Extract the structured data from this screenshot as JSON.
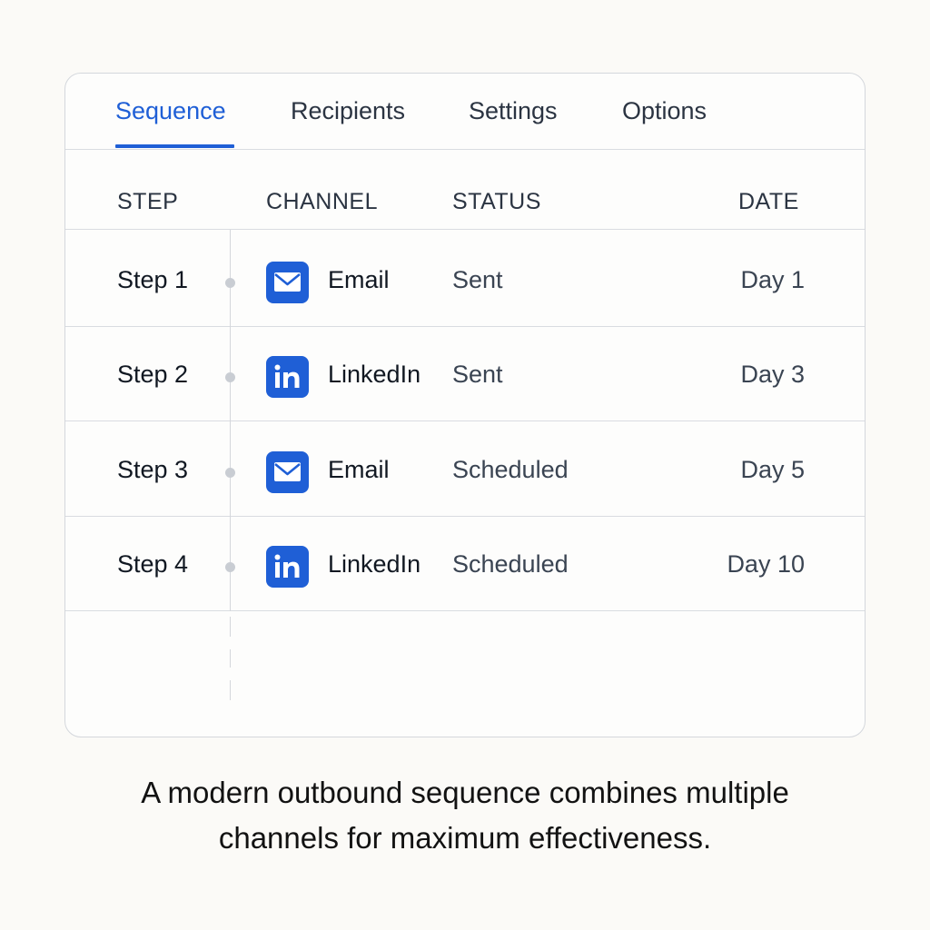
{
  "tabs": [
    {
      "label": "Sequence",
      "active": true
    },
    {
      "label": "Recipients",
      "active": false
    },
    {
      "label": "Settings",
      "active": false
    },
    {
      "label": "Options",
      "active": false
    }
  ],
  "table": {
    "columns": [
      "STEP",
      "CHANNEL",
      "STATUS",
      "DATE"
    ],
    "rows": [
      {
        "step": "Step 1",
        "channel": "Email",
        "channel_icon": "envelope-icon",
        "status": "Sent",
        "date": "Day 1"
      },
      {
        "step": "Step 2",
        "channel": "LinkedIn",
        "channel_icon": "linkedin-icon",
        "status": "Sent",
        "date": "Day 3"
      },
      {
        "step": "Step 3",
        "channel": "Email",
        "channel_icon": "envelope-icon",
        "status": "Scheduled",
        "date": "Day 5"
      },
      {
        "step": "Step 4",
        "channel": "LinkedIn",
        "channel_icon": "linkedin-icon",
        "status": "Scheduled",
        "date": "Day 10"
      }
    ]
  },
  "caption": {
    "line1": "A modern outbound sequence combines multiple",
    "line2": "channels for maximum effectiveness."
  },
  "colors": {
    "accent": "#1f5fd6",
    "border": "#d9dce1",
    "background": "#fbfaf7"
  }
}
